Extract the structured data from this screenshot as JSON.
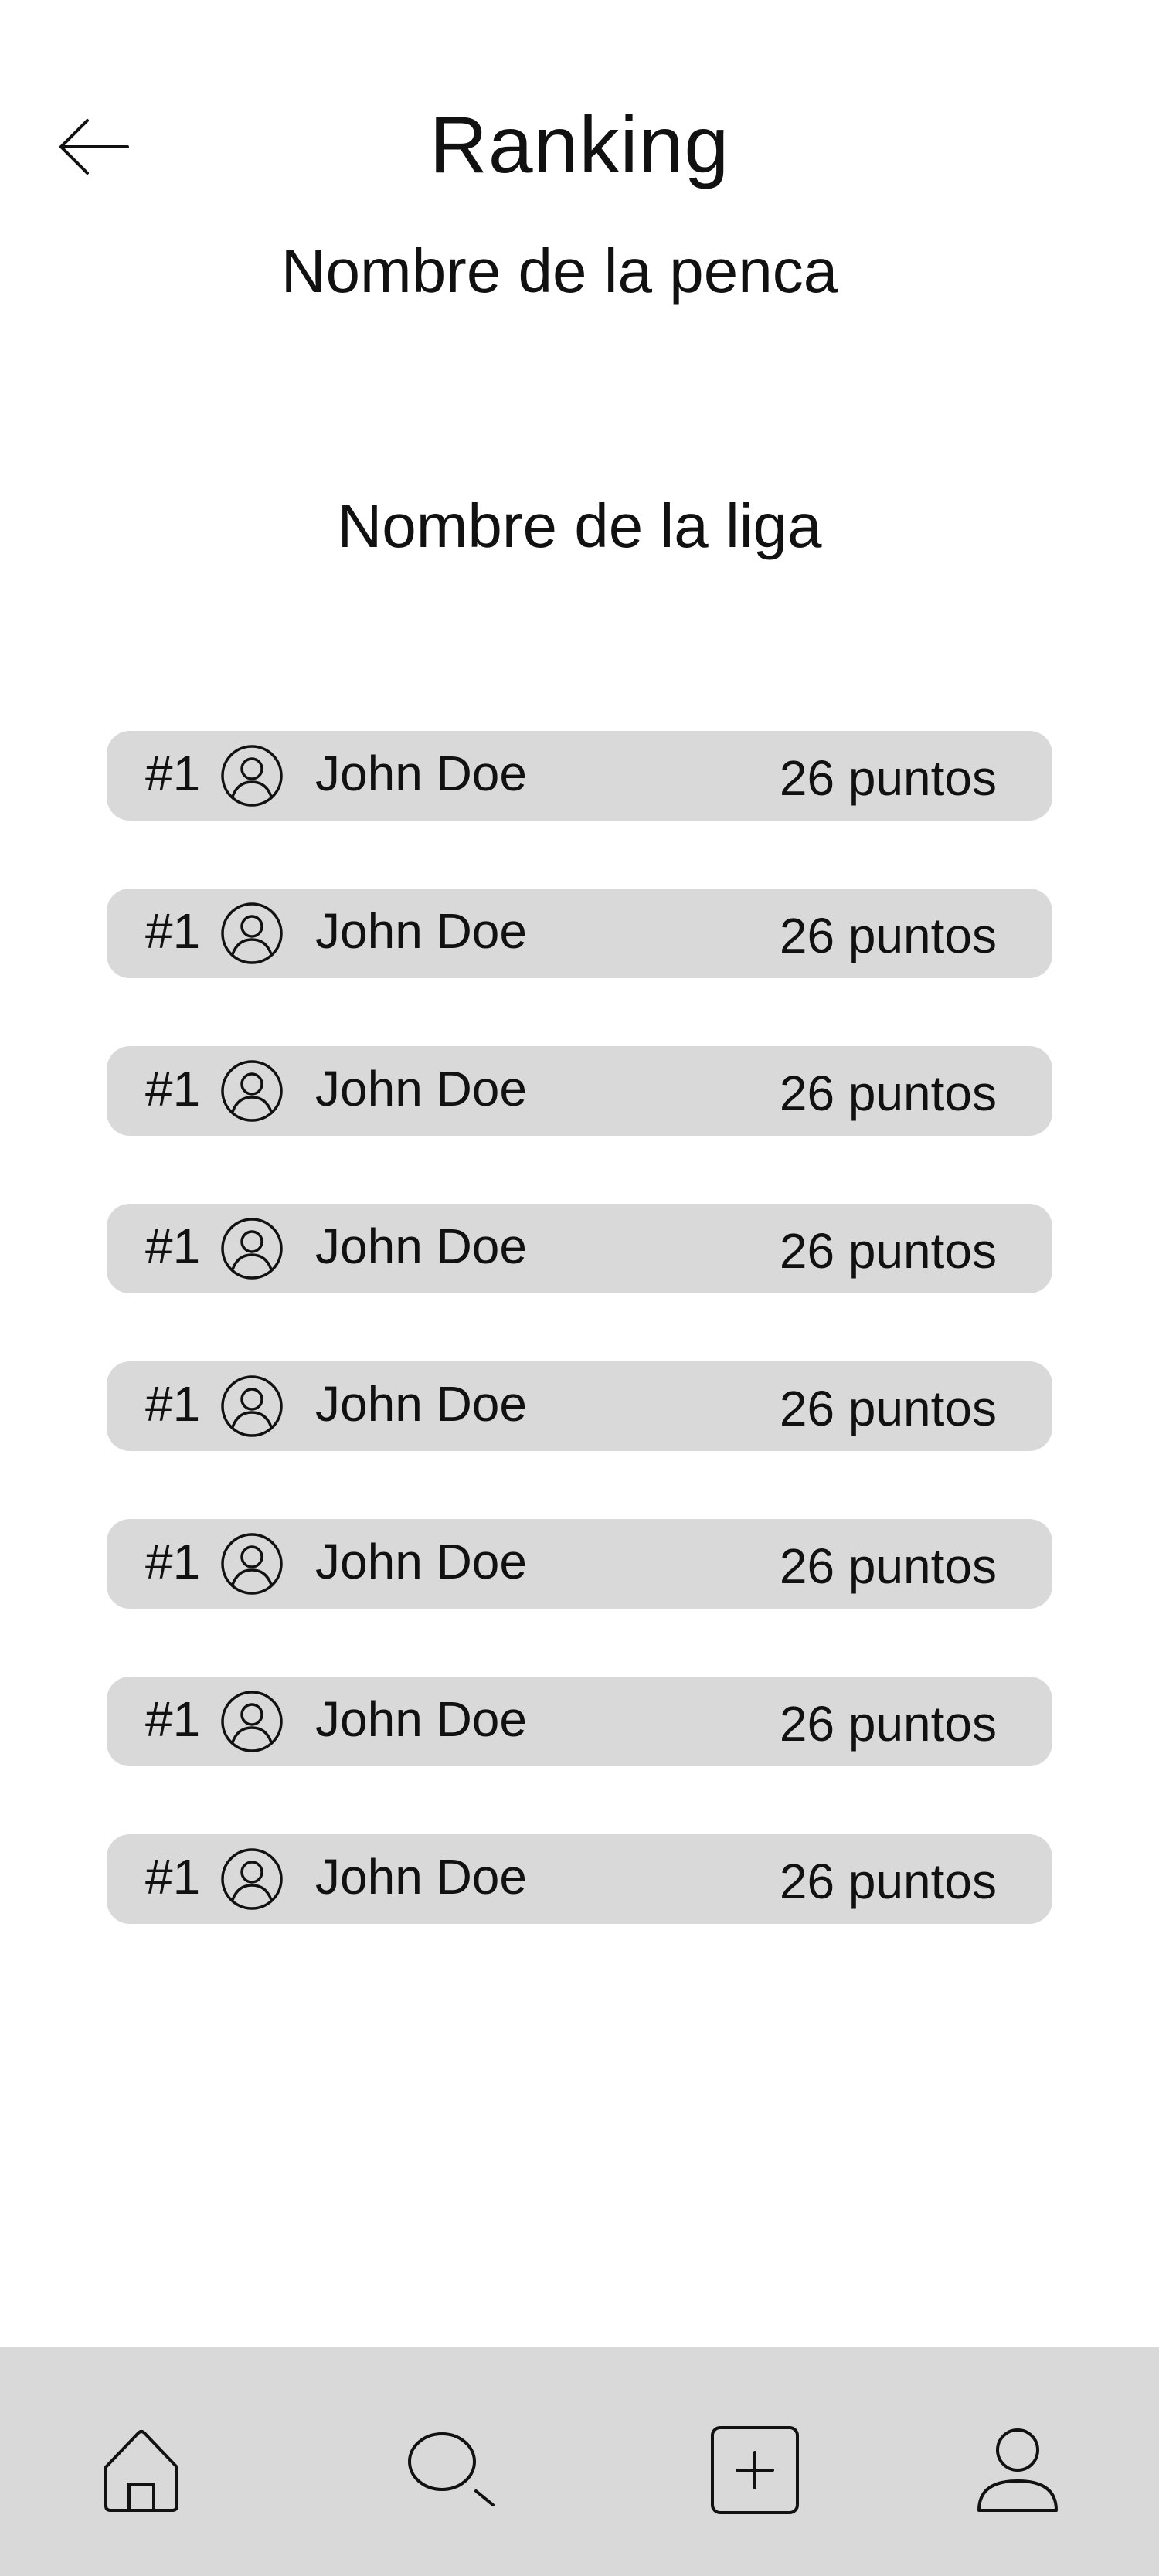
{
  "header": {
    "back_icon": "arrow-left-icon",
    "title": "Ranking",
    "pool_name": "Nombre de la penca"
  },
  "league": {
    "name": "Nombre de la liga"
  },
  "ranking": [
    {
      "rank": "#1",
      "avatar_icon": "user-circle-icon",
      "name": "John Doe",
      "points": "26 puntos"
    },
    {
      "rank": "#1",
      "avatar_icon": "user-circle-icon",
      "name": "John Doe",
      "points": "26 puntos"
    },
    {
      "rank": "#1",
      "avatar_icon": "user-circle-icon",
      "name": "John Doe",
      "points": "26 puntos"
    },
    {
      "rank": "#1",
      "avatar_icon": "user-circle-icon",
      "name": "John Doe",
      "points": "26 puntos"
    },
    {
      "rank": "#1",
      "avatar_icon": "user-circle-icon",
      "name": "John Doe",
      "points": "26 puntos"
    },
    {
      "rank": "#1",
      "avatar_icon": "user-circle-icon",
      "name": "John Doe",
      "points": "26 puntos"
    },
    {
      "rank": "#1",
      "avatar_icon": "user-circle-icon",
      "name": "John Doe",
      "points": "26 puntos"
    },
    {
      "rank": "#1",
      "avatar_icon": "user-circle-icon",
      "name": "John Doe",
      "points": "26 puntos"
    }
  ],
  "bottom_nav": {
    "items": [
      {
        "icon": "home-icon"
      },
      {
        "icon": "search-icon"
      },
      {
        "icon": "plus-square-icon"
      },
      {
        "icon": "profile-icon"
      }
    ]
  },
  "colors": {
    "background": "#ffffff",
    "row_background": "#d9d9d9",
    "nav_background": "#d9d9d9",
    "text": "#111111"
  }
}
